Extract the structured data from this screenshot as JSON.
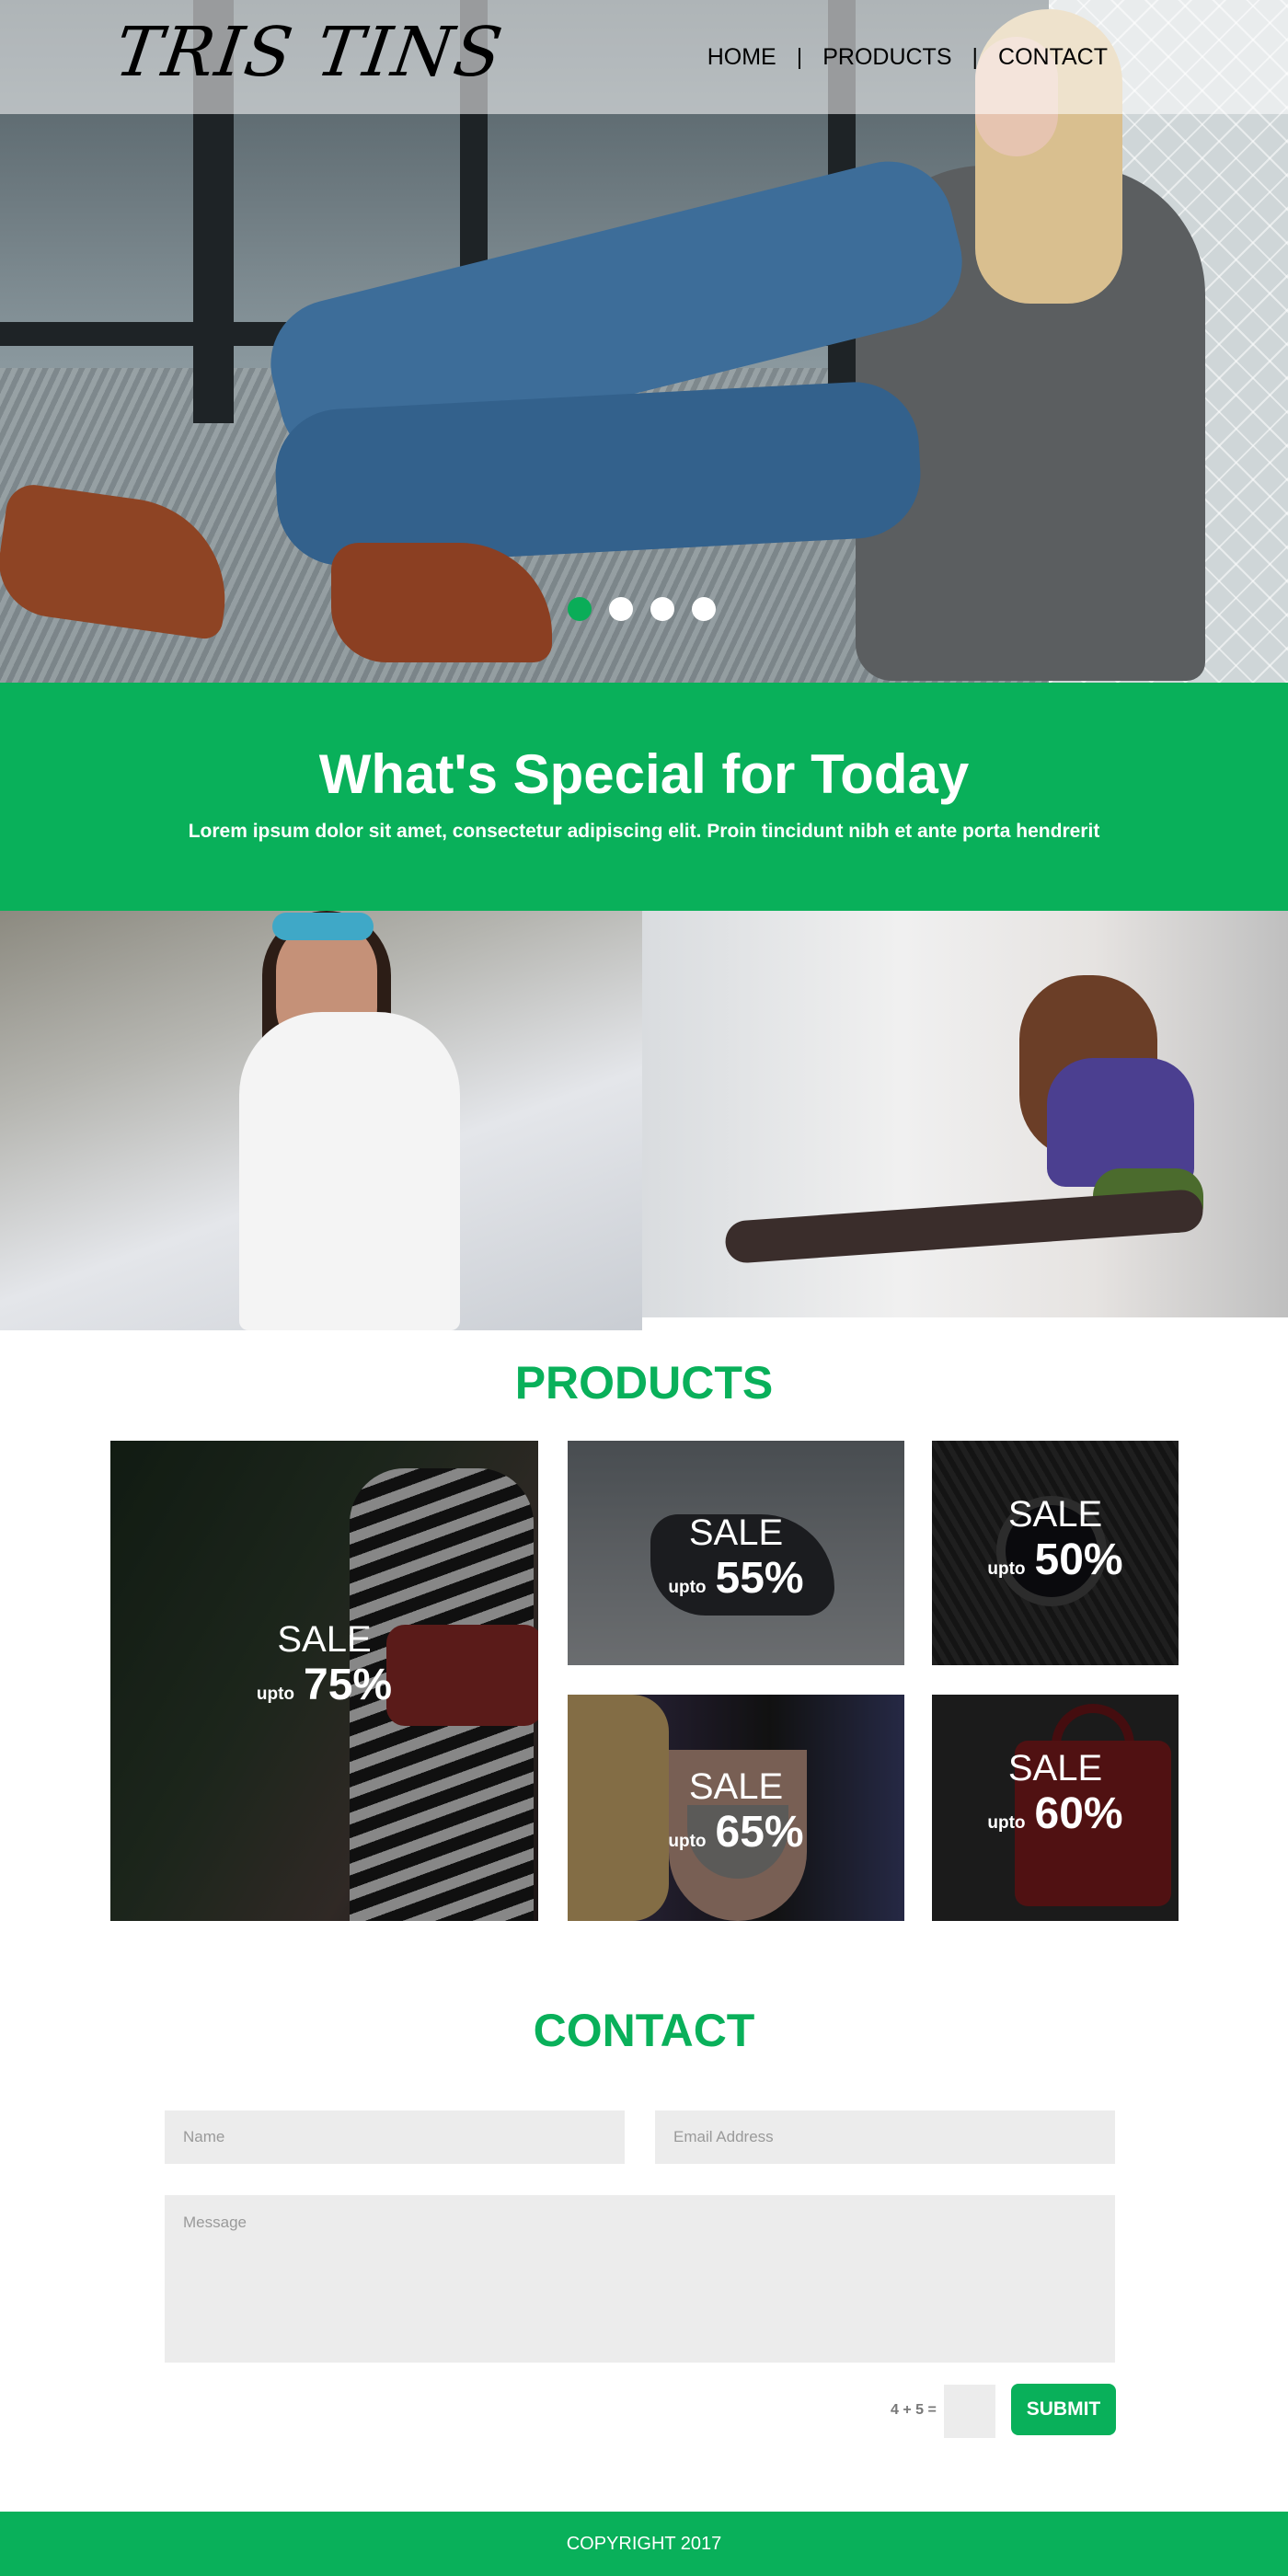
{
  "header": {
    "logo": "TRIS TINS",
    "nav": [
      {
        "label": "HOME"
      },
      {
        "label": "PRODUCTS"
      },
      {
        "label": "CONTACT"
      }
    ],
    "separator": "|"
  },
  "hero": {
    "slides_total": 4,
    "active_slide": 1
  },
  "special": {
    "title": "What's Special for Today",
    "subtitle": "Lorem ipsum dolor sit amet, consectetur adipiscing elit. Proin tincidunt nibh et ante porta hendrerit"
  },
  "products": {
    "title": "PRODUCTS",
    "tiles": [
      {
        "sale": "SALE",
        "upto": "upto",
        "percent": "75%"
      },
      {
        "sale": "SALE",
        "upto": "upto",
        "percent": "55%"
      },
      {
        "sale": "SALE",
        "upto": "upto",
        "percent": "50%"
      },
      {
        "sale": "SALE",
        "upto": "upto",
        "percent": "65%"
      },
      {
        "sale": "SALE",
        "upto": "upto",
        "percent": "60%"
      }
    ]
  },
  "contact": {
    "title": "CONTACT",
    "name_placeholder": "Name",
    "email_placeholder": "Email Address",
    "message_placeholder": "Message",
    "captcha_label": "4 + 5 =",
    "submit_label": "SUBMIT"
  },
  "footer": {
    "copyright": "COPYRIGHT 2017"
  },
  "colors": {
    "accent": "#09b05a",
    "field_bg": "#ececec"
  }
}
